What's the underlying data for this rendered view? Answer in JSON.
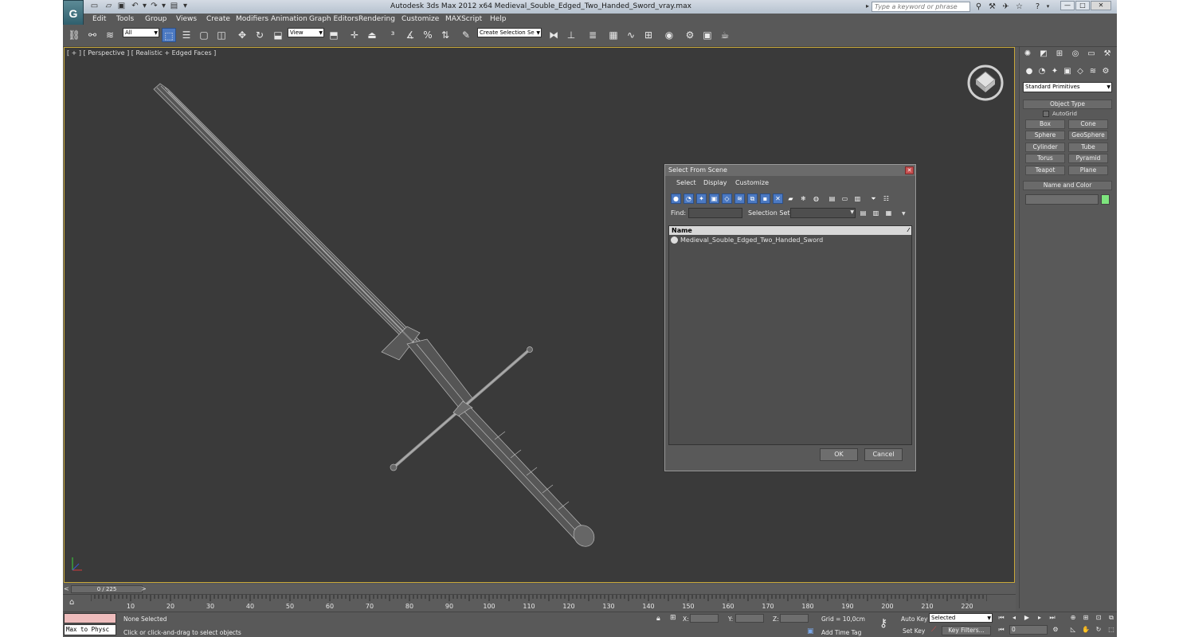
{
  "window": {
    "title": "Autodesk 3ds Max 2012 x64      Medieval_Souble_Edged_Two_Handed_Sword_vray.max",
    "search_placeholder": "Type a keyword or phrase",
    "logo_glyph": "G"
  },
  "menu": [
    "Edit",
    "Tools",
    "Group",
    "Views",
    "Create",
    "Modifiers",
    "Animation",
    "Graph Editors",
    "Rendering",
    "Customize",
    "MAXScript",
    "Help"
  ],
  "toolbar": {
    "filter_value": "All",
    "refcoord_value": "View",
    "selection_set_value": "Create Selection Se"
  },
  "viewport": {
    "label": "[ + ] [ Perspective ] [ Realistic + Edged Faces ]"
  },
  "command_panel": {
    "dropdown_value": "Standard Primitives",
    "object_type_title": "Object Type",
    "autogrid_label": "AutoGrid",
    "buttons": [
      "Box",
      "Cone",
      "Sphere",
      "GeoSphere",
      "Cylinder",
      "Tube",
      "Torus",
      "Pyramid",
      "Teapot",
      "Plane"
    ],
    "name_color_title": "Name and Color",
    "swatch_color": "#7ee57e"
  },
  "dialog": {
    "title": "Select From Scene",
    "menus": [
      "Select",
      "Display",
      "Customize"
    ],
    "find_label": "Find:",
    "selection_set_label": "Selection Set:",
    "column_name": "Name",
    "items": [
      "Medieval_Souble_Edged_Two_Handed_Sword"
    ],
    "ok_label": "OK",
    "cancel_label": "Cancel"
  },
  "timeline": {
    "frame_counter": "0 / 225",
    "ticks": [
      "10",
      "20",
      "30",
      "40",
      "50",
      "60",
      "70",
      "80",
      "90",
      "100",
      "110",
      "120",
      "130",
      "140",
      "150",
      "160",
      "170",
      "180",
      "190",
      "200",
      "210",
      "220"
    ]
  },
  "status": {
    "maxscript_text": "Max to Physc",
    "selection_text": "None Selected",
    "prompt_text": "Click or click-and-drag to select objects",
    "x_label": "X:",
    "y_label": "Y:",
    "z_label": "Z:",
    "grid_text": "Grid = 10,0cm",
    "add_time_tag": "Add Time Tag",
    "auto_key": "Auto Key",
    "set_key": "Set Key",
    "key_mode_value": "Selected",
    "key_filters": "Key Filters...",
    "frame_value": "0"
  }
}
